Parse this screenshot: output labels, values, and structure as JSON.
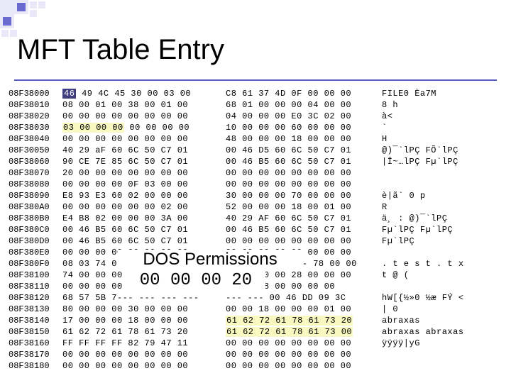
{
  "title": "MFT Table Entry",
  "callout": {
    "label": "DOS Permissions",
    "bytes": "00 00 00 20"
  },
  "hex": {
    "rows": [
      {
        "off": "08F38000",
        "h1": "46 49 4C 45 30 00 03 00",
        "h2": "C8 61 37 4D 0F 00 00 00",
        "asc": "FILE0   Èa7M"
      },
      {
        "off": "08F38010",
        "h1": "08 00 01 00 38 00 01 00",
        "h2": "68 01 00 00 00 04 00 00",
        "asc": "    8   h"
      },
      {
        "off": "08F38020",
        "h1": "00 00 00 00 00 00 00 00",
        "h2": "04 00 00 00 E0 3C 02 00",
        "asc": "            à<"
      },
      {
        "off": "08F38030",
        "h1": "03 00 00 00 00 00 00 00",
        "h2": "10 00 00 00 60 00 00 00",
        "asc": "             `"
      },
      {
        "off": "08F38040",
        "h1": "00 00 00 00 00 00 00 00",
        "h2": "48 00 00 00 18 00 00 00",
        "asc": "        H"
      },
      {
        "off": "08F30050",
        "h1": "40 29 aF 60 6C 50 C7 01",
        "h2": "00 46 D5 60 6C 50 C7 01",
        "asc": "@)¯`lPÇ  FÕ`lPÇ"
      },
      {
        "off": "08F38060",
        "h1": "90 CE 7E 85 6C 50 C7 01",
        "h2": "00 46 B5 60 6C 50 C7 01",
        "asc": "|Î~…lPÇ  Fµ`lPÇ"
      },
      {
        "off": "08F38070",
        "h1": "20 00 00 00 00 00 00 00",
        "h2": "00 00 00 00 00 00 00 00",
        "asc": ""
      },
      {
        "off": "08F38080",
        "h1": "00 00 00 00 0F 03 00 00",
        "h2": "00 00 00 00 00 00 00 00",
        "asc": ""
      },
      {
        "off": "08F38090",
        "h1": "E8 93 E3 60 02 00 00 00",
        "h2": "30 00 00 00 70 00 00 00",
        "asc": "è|ã`    0   p"
      },
      {
        "off": "08F380A0",
        "h1": "00 00 00 00 00 00 02 00",
        "h2": "52 00 00 00 18 00 01 00",
        "asc": "        R"
      },
      {
        "off": "08F380B0",
        "h1": "E4 B8 02 00 00 00 3A 00",
        "h2": "40 29 AF 60 6C 50 C7 01",
        "asc": "ä¸    :  @)¯`lPÇ"
      },
      {
        "off": "08F380C0",
        "h1": "00 46 B5 60 6C 50 C7 01",
        "h2": "00 46 B5 60 6C 50 C7 01",
        "asc": " Fµ`lPÇ  Fµ`lPÇ"
      },
      {
        "off": "08F380D0",
        "h1": "00 46 B5 60 6C 50 C7 01",
        "h2": "00 00 00 00 00 00 00 00",
        "asc": " Fµ`lPÇ"
      },
      {
        "off": "08F380E0",
        "h1": "00 00 00 00 00 00 00 00",
        "h2": "20 00 00 00 00 00 00 00",
        "asc": ""
      },
      {
        "off": "08F380F0",
        "h1": "08 03 74 0 --- --- --- ---",
        "h2": "--- --- --- --- 78 00 00",
        "asc": ". t e s t . t x"
      },
      {
        "off": "08F38100",
        "h1": "74 00 00 00 -- -- -- --",
        "h2": "40 00 00 00 28 00 00 00",
        "asc": "t       @   ("
      },
      {
        "off": "08F38110",
        "h1": "00 00 00 00 -- -- -- --",
        "h2": "00 00 18 00 00 00 00",
        "asc": ""
      },
      {
        "off": "08F38120",
        "h1": "68 57 5B 7--- --- --- ---",
        "h2": "--- --- 00 46 DD 09 3C",
        "asc": "hW[{½»0 ½æ  FÝ <"
      },
      {
        "off": "08F38130",
        "h1": "80 00 00 00 30 00 00 00",
        "h2": "00 00 18 00 00 00 01 00",
        "asc": "|   0"
      },
      {
        "off": "08F38140",
        "h1": "17 00 00 00 18 00 00 00",
        "h2": "61 62 72 61 78 61 73 20",
        "asc": "        abraxas"
      },
      {
        "off": "08F38150",
        "h1": "61 62 72 61 78 61 73 20",
        "h2": "61 62 72 61 78 61 73 00",
        "asc": "abraxas abraxas"
      },
      {
        "off": "08F38160",
        "h1": "FF FF FF FF 82 79 47 11",
        "h2": "00 00 00 00 00 00 00 00",
        "asc": "ÿÿÿÿ|yG"
      },
      {
        "off": "08F38170",
        "h1": "00 00 00 00 00 00 00 00",
        "h2": "00 00 00 00 00 00 00 00",
        "asc": ""
      },
      {
        "off": "08F38180",
        "h1": "00 00 00 00 00 00 00 00",
        "h2": "00 00 00 00 00 00 00 00",
        "asc": ""
      }
    ]
  }
}
